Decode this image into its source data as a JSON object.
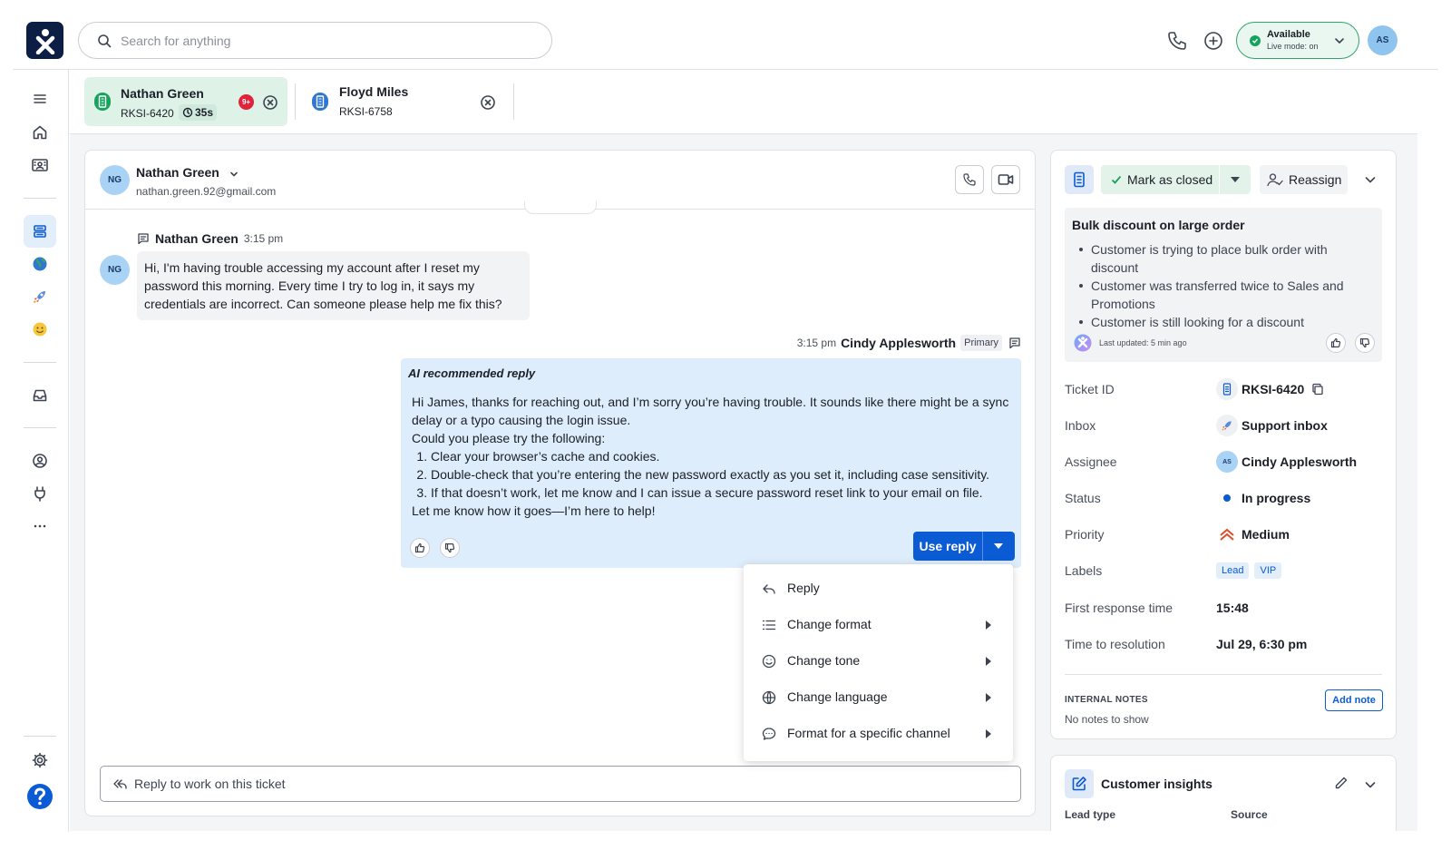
{
  "colors": {
    "brand_navy": "#0d1e44",
    "primary_blue": "#0b5bd4",
    "available_green": "#17a35b",
    "active_tab_bg": "#dff2e8",
    "ai_reply_bg": "#deedfb"
  },
  "header": {
    "search_placeholder": "Search for anything",
    "status": {
      "label": "Available",
      "sublabel": "Live mode: on"
    },
    "user_initials": "AS"
  },
  "rail": {
    "icons": [
      "menu-icon",
      "home-icon",
      "contacts-icon",
      "tickets-icon",
      "globe-icon",
      "rocket-icon",
      "smiley-icon",
      "inbox-icon",
      "user-circle-icon",
      "plug-icon",
      "more-icon",
      "settings-icon",
      "help-icon"
    ]
  },
  "tabs": [
    {
      "name": "Nathan Green",
      "id": "RKSI-6420",
      "timer": "35s",
      "badge": "9+"
    },
    {
      "name": "Floyd Miles",
      "id": "RKSI-6758"
    }
  ],
  "conversation": {
    "contact": {
      "initials": "NG",
      "name": "Nathan Green",
      "email": "nathan.green.92@gmail.com"
    },
    "customer_message": {
      "author": "Nathan Green",
      "time": "3:15 pm",
      "initials": "NG",
      "text": "Hi, I'm having trouble accessing my account after I reset my password this morning. Every time I try to log in, it says my credentials are incorrect. Can someone please help me fix this?"
    },
    "agent_message": {
      "time": "3:15 pm",
      "author": "Cindy Applesworth",
      "tag": "Primary",
      "ai_title": "AI recommended reply",
      "intro": "Hi James, thanks for reaching out, and I’m sorry you’re having trouble. It sounds like there might be a sync delay or a typo causing the login issue.",
      "lead": "Could you please try the following:",
      "steps": [
        "Clear your browser’s cache and cookies.",
        "Double-check that you’re entering the new password exactly as you set it, including case sensitivity.",
        "If that doesn’t work, let me know and I can issue a secure password reset link to your email on file."
      ],
      "closing": "Let me know how it goes—I’m here to help!",
      "use_reply_label": "Use reply"
    },
    "menu": [
      {
        "label": "Reply",
        "icon": "reply-icon",
        "submenu": false
      },
      {
        "label": "Change format",
        "icon": "list-icon",
        "submenu": true
      },
      {
        "label": "Change tone",
        "icon": "smiley-icon",
        "submenu": true
      },
      {
        "label": "Change language",
        "icon": "globe-icon",
        "submenu": true
      },
      {
        "label": "Format for a specific channel",
        "icon": "chat-icon",
        "submenu": true
      }
    ],
    "reply_placeholder": "Reply to work on this ticket"
  },
  "details": {
    "mark_closed_label": "Mark as closed",
    "reassign_label": "Reassign",
    "summary": {
      "title": "Bulk discount on large order",
      "bullets": [
        "Customer is trying to place bulk order with discount",
        "Customer was transferred twice to Sales and Promotions",
        "Customer is still looking for a discount"
      ],
      "updated": "Last updated: 5 min ago"
    },
    "fields": {
      "ticket_id": {
        "label": "Ticket ID",
        "value": "RKSI-6420"
      },
      "inbox": {
        "label": "Inbox",
        "value": "Support inbox"
      },
      "assignee": {
        "label": "Assignee",
        "value": "Cindy Applesworth",
        "initials": "AS"
      },
      "status": {
        "label": "Status",
        "value": "In progress"
      },
      "priority": {
        "label": "Priority",
        "value": "Medium"
      },
      "labels": {
        "label": "Labels",
        "values": [
          "Lead",
          "VIP"
        ]
      },
      "first_response": {
        "label": "First response time",
        "value": "15:48"
      },
      "resolution": {
        "label": "Time to resolution",
        "value": "Jul 29, 6:30 pm"
      }
    },
    "notes": {
      "title": "INTERNAL NOTES",
      "empty": "No notes to show",
      "add_label": "Add note"
    }
  },
  "insights": {
    "title": "Customer insights",
    "lead_type_label": "Lead type",
    "source_label": "Source"
  }
}
